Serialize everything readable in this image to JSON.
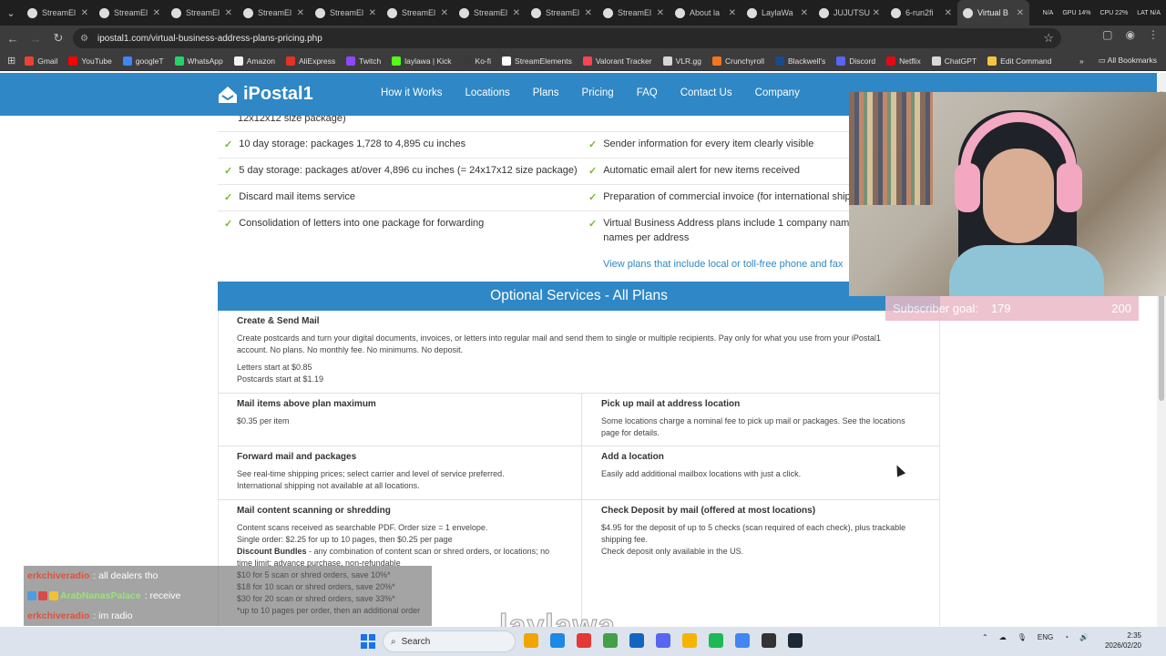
{
  "browser": {
    "tabs": [
      {
        "label": "StreamEl",
        "active": false
      },
      {
        "label": "StreamEl",
        "active": false
      },
      {
        "label": "StreamEl",
        "active": false
      },
      {
        "label": "StreamEl",
        "active": false
      },
      {
        "label": "StreamEl",
        "active": false
      },
      {
        "label": "StreamEl",
        "active": false
      },
      {
        "label": "StreamEl",
        "active": false
      },
      {
        "label": "StreamEl",
        "active": false
      },
      {
        "label": "StreamEl",
        "active": false
      },
      {
        "label": "About la",
        "active": false
      },
      {
        "label": "LaylaWa",
        "active": false
      },
      {
        "label": "JUJUTSU",
        "active": false
      },
      {
        "label": "6-run2fi",
        "active": false
      },
      {
        "label": "Virtual B",
        "active": true
      }
    ],
    "sysmon": [
      "N/A",
      "GPU 14%",
      "CPU 22%",
      "LAT N/A"
    ],
    "url": "ipostal1.com/virtual-business-address-plans-pricing.php",
    "bookmarks": [
      "Gmail",
      "YouTube",
      "googleT",
      "WhatsApp",
      "Amazon",
      "AliExpress",
      "Twitch",
      "laylawa | Kick",
      "Ko-fi",
      "StreamElements",
      "Valorant Tracker",
      "VLR.gg",
      "Crunchyroll",
      "Blackwell's",
      "Discord",
      "Netflix",
      "ChatGPT",
      "Edit Command"
    ],
    "bookmark_colors": [
      "#ea4335",
      "#ff0000",
      "#4285f4",
      "#25d366",
      "#f2f2f2",
      "#e43225",
      "#9146ff",
      "#53fc18",
      "#3a3a3a",
      "#ffffff",
      "#fa4454",
      "#d6d6d6",
      "#f47521",
      "#1a4a8c",
      "#5865f2",
      "#e50914",
      "#d9d9d9",
      "#f4c542"
    ],
    "all_bookmarks": "All Bookmarks"
  },
  "site": {
    "logo": "iPostal1",
    "nav": [
      "How it Works",
      "Locations",
      "Plans",
      "Pricing",
      "FAQ",
      "Contact Us",
      "Company"
    ],
    "partial_top": "12x12x12 size package)",
    "features_left": [
      "10 day storage: packages 1,728 to 4,895 cu inches",
      "5 day storage: packages at/over 4,896 cu inches (= 24x17x12 size package)",
      "Discard mail items service",
      "Consolidation of letters into one package for forwarding"
    ],
    "features_right": [
      "Sender information for every item clearly visible",
      "Automatic email alert for new items received",
      "Preparation of commercial invoice (for international shipm",
      "Virtual Business Address plans include 1 company name",
      "names per address"
    ],
    "view_plans_link": "View plans that include local or toll-free phone and fax",
    "optional_title": "Optional Services - All Plans",
    "create_send": {
      "title": "Create & Send Mail",
      "text1": "Create postcards and turn your digital documents, invoices, or letters into regular mail and send them to single or multiple recipients. Pay only for what you use from your iPostal1",
      "text2": "account. No plans. No monthly fee. No minimums. No deposit.",
      "letters": "Letters start at $0.85",
      "postcards": "Postcards start at $1.19"
    },
    "services": {
      "mail_above": {
        "title": "Mail items above plan maximum",
        "text": "$0.35 per item"
      },
      "pickup": {
        "title": "Pick up mail at address location",
        "text1": "Some locations charge a nominal fee to pick up mail or packages. See the locations",
        "text2": "page for details."
      },
      "forward": {
        "title": "Forward mail and packages",
        "text1": "See real-time shipping prices; select carrier and level of service preferred.",
        "text2": "International shipping not available at all locations."
      },
      "add_location": {
        "title": "Add a location",
        "text": "Easily add additional mailbox locations with just a click."
      },
      "scanning": {
        "title": "Mail content scanning or shredding",
        "line1": "Content scans received as searchable PDF. Order size = 1 envelope.",
        "line2": "Single order: $2.25 for up to 10 pages, then $0.25 per page",
        "bundles_label": "Discount Bundles",
        "line3": " - any combination of content scan or shred orders, or locations; no",
        "line4": "time limit; advance purchase, non-refundable",
        "line5": "$10 for 5 scan or shred orders, save 10%*",
        "line6": "$18 for 10 scan or shred orders, save 20%*",
        "line7": "$30 for 20 scan or shred orders, save 33%*",
        "line8": "*up to 10 pages per order, then an additional order"
      },
      "deposit": {
        "title": "Check Deposit by mail (offered at most locations)",
        "text1": "$4.95 for the deposit of up to 5 checks (scan required of each check), plus trackable",
        "text2": "shipping fee.",
        "text3": "Check deposit only available in the US."
      }
    }
  },
  "stream": {
    "subgoal_label": "Subscriber goal:",
    "subgoal_current": "179",
    "subgoal_target": "200",
    "chat": [
      {
        "user": "erkchiveradio",
        "message": ": all dealers tho",
        "color": "red"
      },
      {
        "user": "ArabNanasPalace",
        "message": ": receive",
        "color": "green"
      },
      {
        "user": "erkchiveradio",
        "message": ": im radio",
        "color": "red"
      }
    ],
    "watermark": "laylawa"
  },
  "taskbar": {
    "search": "Search",
    "lang": "ENG",
    "time": "2:35",
    "date": "2026/02/20",
    "app_colors": [
      "#f0a500",
      "#1e88e5",
      "#e53935",
      "#43a047",
      "#1565c0",
      "#5865f2",
      "#f5b400",
      "#1db954",
      "#4285f4",
      "#333333",
      "#1b2838"
    ]
  }
}
